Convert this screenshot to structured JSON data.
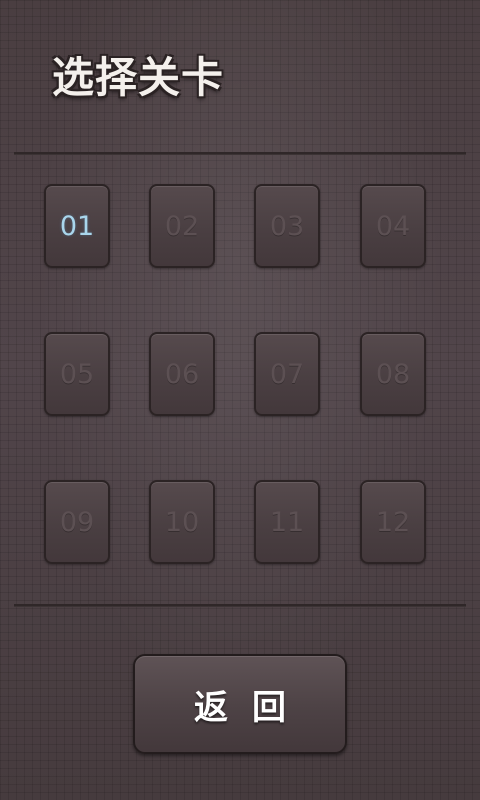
{
  "title": "选择关卡",
  "levels": [
    {
      "label": "01",
      "unlocked": true
    },
    {
      "label": "02",
      "unlocked": false
    },
    {
      "label": "03",
      "unlocked": false
    },
    {
      "label": "04",
      "unlocked": false
    },
    {
      "label": "05",
      "unlocked": false
    },
    {
      "label": "06",
      "unlocked": false
    },
    {
      "label": "07",
      "unlocked": false
    },
    {
      "label": "08",
      "unlocked": false
    },
    {
      "label": "09",
      "unlocked": false
    },
    {
      "label": "10",
      "unlocked": false
    },
    {
      "label": "11",
      "unlocked": false
    },
    {
      "label": "12",
      "unlocked": false
    }
  ],
  "back_label": "返回",
  "colors": {
    "background": "#4b3f41",
    "unlocked_text": "#a9d6ec",
    "locked_text": "#5c5053"
  }
}
